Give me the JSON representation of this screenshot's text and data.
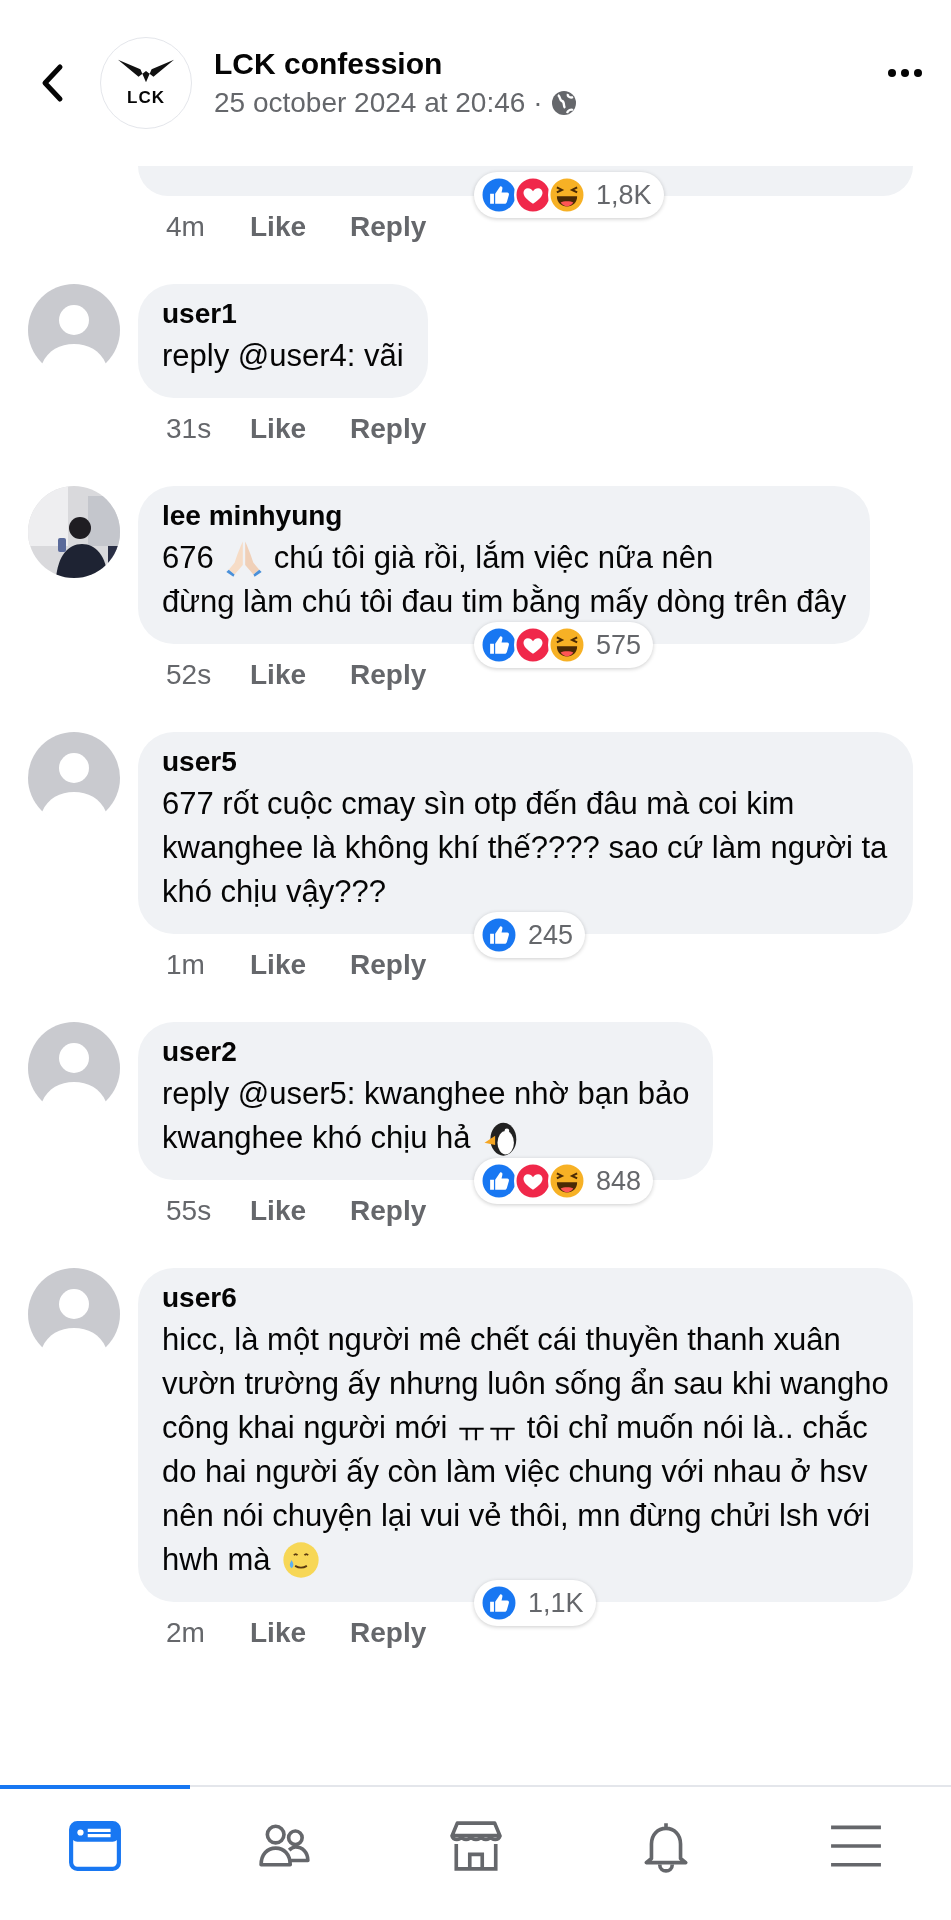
{
  "header": {
    "logo_text": "LCK",
    "title": "LCK confession",
    "date": "25 october 2024 at 20:46 ·"
  },
  "cut_comment": {
    "time": "4m",
    "like": "Like",
    "reply": "Reply",
    "reactions": [
      {
        "kind": "like"
      },
      {
        "kind": "love"
      },
      {
        "kind": "haha"
      }
    ],
    "count": "1,8K"
  },
  "comments": [
    {
      "avatar": {
        "kind": "default"
      },
      "name": "user1",
      "body": [
        [
          {
            "text": "reply @user4: vãi"
          }
        ]
      ],
      "time": "31s",
      "like": "Like",
      "reply": "Reply"
    },
    {
      "avatar": {
        "kind": "picture"
      },
      "name": "lee minhyung",
      "body": [
        [
          {
            "text": "676"
          },
          {
            "kind": "pray"
          },
          {
            "text": "chú tôi già rồi, lắm việc nữa nên"
          }
        ],
        [
          {
            "text": "đừng làm chú tôi đau tim bằng mấy dòng trên đây"
          }
        ]
      ],
      "time": "52s",
      "like": "Like",
      "reply": "Reply",
      "reactions": [
        {
          "kind": "like"
        },
        {
          "kind": "love"
        },
        {
          "kind": "haha"
        }
      ],
      "count": "575"
    },
    {
      "avatar": {
        "kind": "default"
      },
      "name": "user5",
      "body": [
        [
          {
            "text": "677 rốt cuộc cmay sìn otp đến đâu mà coi kim kwanghee là không khí thế???? sao cứ làm người ta khó chịu vậy???"
          }
        ]
      ],
      "time": "1m",
      "like": "Like",
      "reply": "Reply",
      "reactions": [
        {
          "kind": "like"
        }
      ],
      "count": "245"
    },
    {
      "avatar": {
        "kind": "default"
      },
      "name": "user2",
      "body": [
        [
          {
            "text": "reply @user5: kwanghee nhờ bạn bảo"
          }
        ],
        [
          {
            "text": "kwanghee khó chịu hả"
          },
          {
            "kind": "penguin"
          }
        ]
      ],
      "time": "55s",
      "like": "Like",
      "reply": "Reply",
      "reactions": [
        {
          "kind": "like"
        },
        {
          "kind": "love"
        },
        {
          "kind": "haha"
        }
      ],
      "count": "848"
    },
    {
      "avatar": {
        "kind": "default"
      },
      "name": "user6",
      "body": [
        [
          {
            "text": "hicc, là một người mê chết cái thuyền thanh xuân vườn trường ấy nhưng luôn sống ẩn sau khi wangho công khai người mới ㅠㅠ tôi chỉ muốn nói là.. chắc do hai người ấy còn làm việc chung với nhau ở hsv nên nói chuyện lại vui vẻ thôi, mn đừng chửi lsh với"
          }
        ],
        [
          {
            "text": "hwh mà"
          },
          {
            "kind": "smile-tear"
          }
        ]
      ],
      "time": "2m",
      "like": "Like",
      "reply": "Reply",
      "reactions": [
        {
          "kind": "like"
        }
      ],
      "count": "1,1K"
    }
  ],
  "nav": [
    {
      "selected": true
    },
    {
      "selected": false
    },
    {
      "selected": false
    },
    {
      "selected": false
    },
    {
      "selected": false
    }
  ]
}
